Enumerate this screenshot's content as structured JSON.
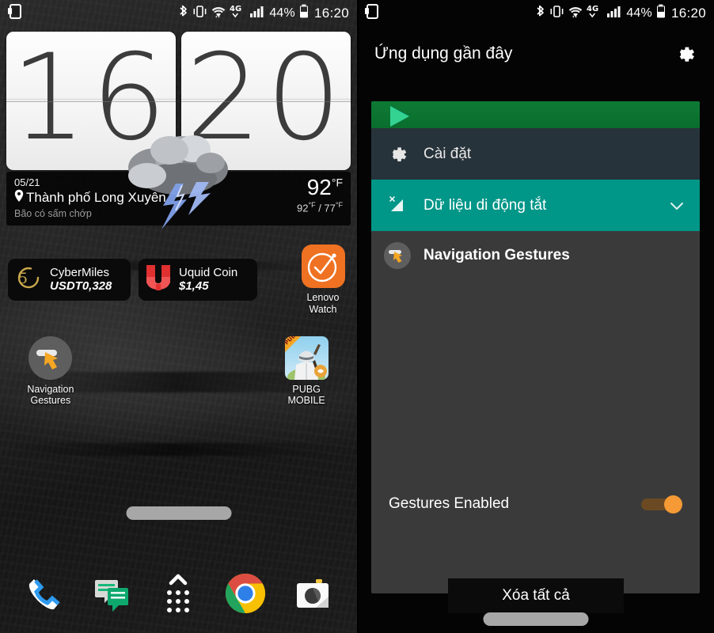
{
  "status_bar": {
    "left_icons": [
      "sim-card-icon"
    ],
    "right_icons": [
      "bluetooth-icon",
      "vibrate-icon",
      "wifi-icon",
      "network-4g-icon",
      "signal-bars-icon",
      "battery-icon"
    ],
    "network_label": "4G",
    "battery_percent": "44%",
    "time": "16:20"
  },
  "home": {
    "clock": {
      "hours": "16",
      "minutes": "20",
      "weather_icon": "thunderstorm-icon"
    },
    "weather": {
      "date": "05/21",
      "location_icon": "location-pin-icon",
      "city": "Thành phố Long Xuyên",
      "condition": "Bão có sấm chớp",
      "temp": "92",
      "temp_unit": "°F",
      "high": "92",
      "high_unit": "°F",
      "low": "77",
      "low_unit": "°F"
    },
    "crypto_widgets": [
      {
        "icon": "cybermiles-icon",
        "name": "CyberMiles",
        "value": "USDT0,328"
      },
      {
        "icon": "uquid-coin-icon",
        "name": "Uquid Coin",
        "value": "$1,45"
      }
    ],
    "apps_row1": [
      {
        "icon": "lenovo-watch-icon",
        "label_line1": "Lenovo",
        "label_line2": "Watch"
      }
    ],
    "apps_row2": [
      {
        "icon": "navigation-gestures-icon",
        "label_line1": "Navigation",
        "label_line2": "Gestures"
      },
      {
        "icon": "pubg-mobile-icon",
        "label_line1": "PUBG",
        "label_line2": "MOBILE"
      }
    ],
    "dock": [
      {
        "icon": "phone-icon",
        "name": "Phone"
      },
      {
        "icon": "messages-icon",
        "name": "Messages"
      },
      {
        "icon": "app-drawer-icon",
        "name": "App drawer"
      },
      {
        "icon": "chrome-icon",
        "name": "Chrome"
      },
      {
        "icon": "camera-icon",
        "name": "Camera"
      }
    ],
    "nav_handle": "navigation-gesture-pill"
  },
  "recents": {
    "title": "Ứng dụng gần đây",
    "settings_icon": "gear-icon",
    "cards": [
      {
        "type": "play-store-card",
        "icon": "play-store-icon",
        "label": ""
      },
      {
        "type": "settings-row",
        "icon": "gear-icon",
        "label": "Cài đặt"
      },
      {
        "type": "data-row",
        "icon": "mobile-data-off-icon",
        "label": "Dữ liệu di động tắt",
        "chevron": "chevron-down-icon"
      },
      {
        "type": "app-row",
        "icon": "navigation-gestures-icon",
        "label": "Navigation Gestures"
      }
    ],
    "gestures_toggle": {
      "label": "Gestures Enabled",
      "state": "on"
    },
    "clear_all": "Xóa tất cả",
    "nav_handle": "navigation-gesture-pill"
  },
  "colors": {
    "accent_teal": "#009688",
    "settings_row_bg": "#27333a",
    "play_green": "#0d7a34",
    "toggle_on": "#f59a35",
    "card_bg": "#3a3a3a"
  }
}
